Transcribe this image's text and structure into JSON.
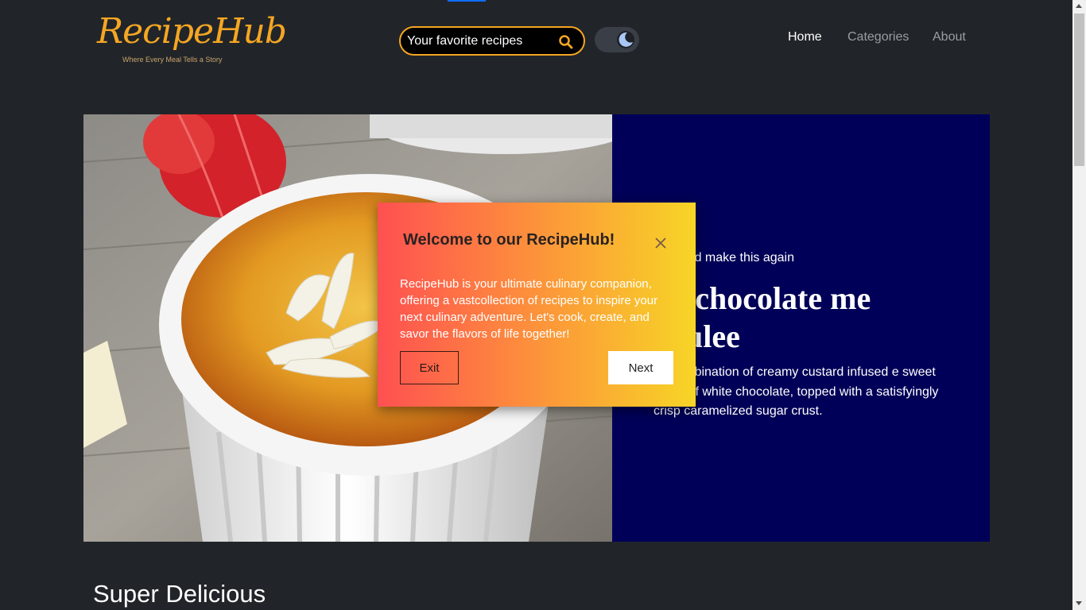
{
  "brand": {
    "name": "RecipeHub",
    "tagline": "Where Every Meal Tells a Story",
    "accent_color": "#f5a623"
  },
  "search": {
    "placeholder": "Your favorite recipes",
    "icon": "search-icon"
  },
  "theme_toggle": {
    "icon": "moon-icon",
    "mode": "dark"
  },
  "nav": {
    "items": [
      {
        "label": "Home",
        "active": true
      },
      {
        "label": "Categories",
        "active": false
      },
      {
        "label": "About",
        "active": false
      }
    ]
  },
  "hero": {
    "rating": "% would make this again",
    "title": "ite chocolate me brulee",
    "description": "ful combination of creamy custard infused e sweet flavor of white chocolate, topped with a satisfyingly crisp caramelized sugar crust.",
    "panel_color": "#000058"
  },
  "modal": {
    "title": "Welcome to our RecipeHub!",
    "body": "RecipeHub is your ultimate culinary companion, offering a vastcollection of recipes to inspire your next culinary adventure. Let's cook, create, and savor the flavors of life together!",
    "exit_label": "Exit",
    "next_label": "Next",
    "gradient": [
      "#fe5051",
      "#fd8c3d",
      "#f7d526"
    ]
  },
  "section": {
    "title": "Super Delicious"
  }
}
